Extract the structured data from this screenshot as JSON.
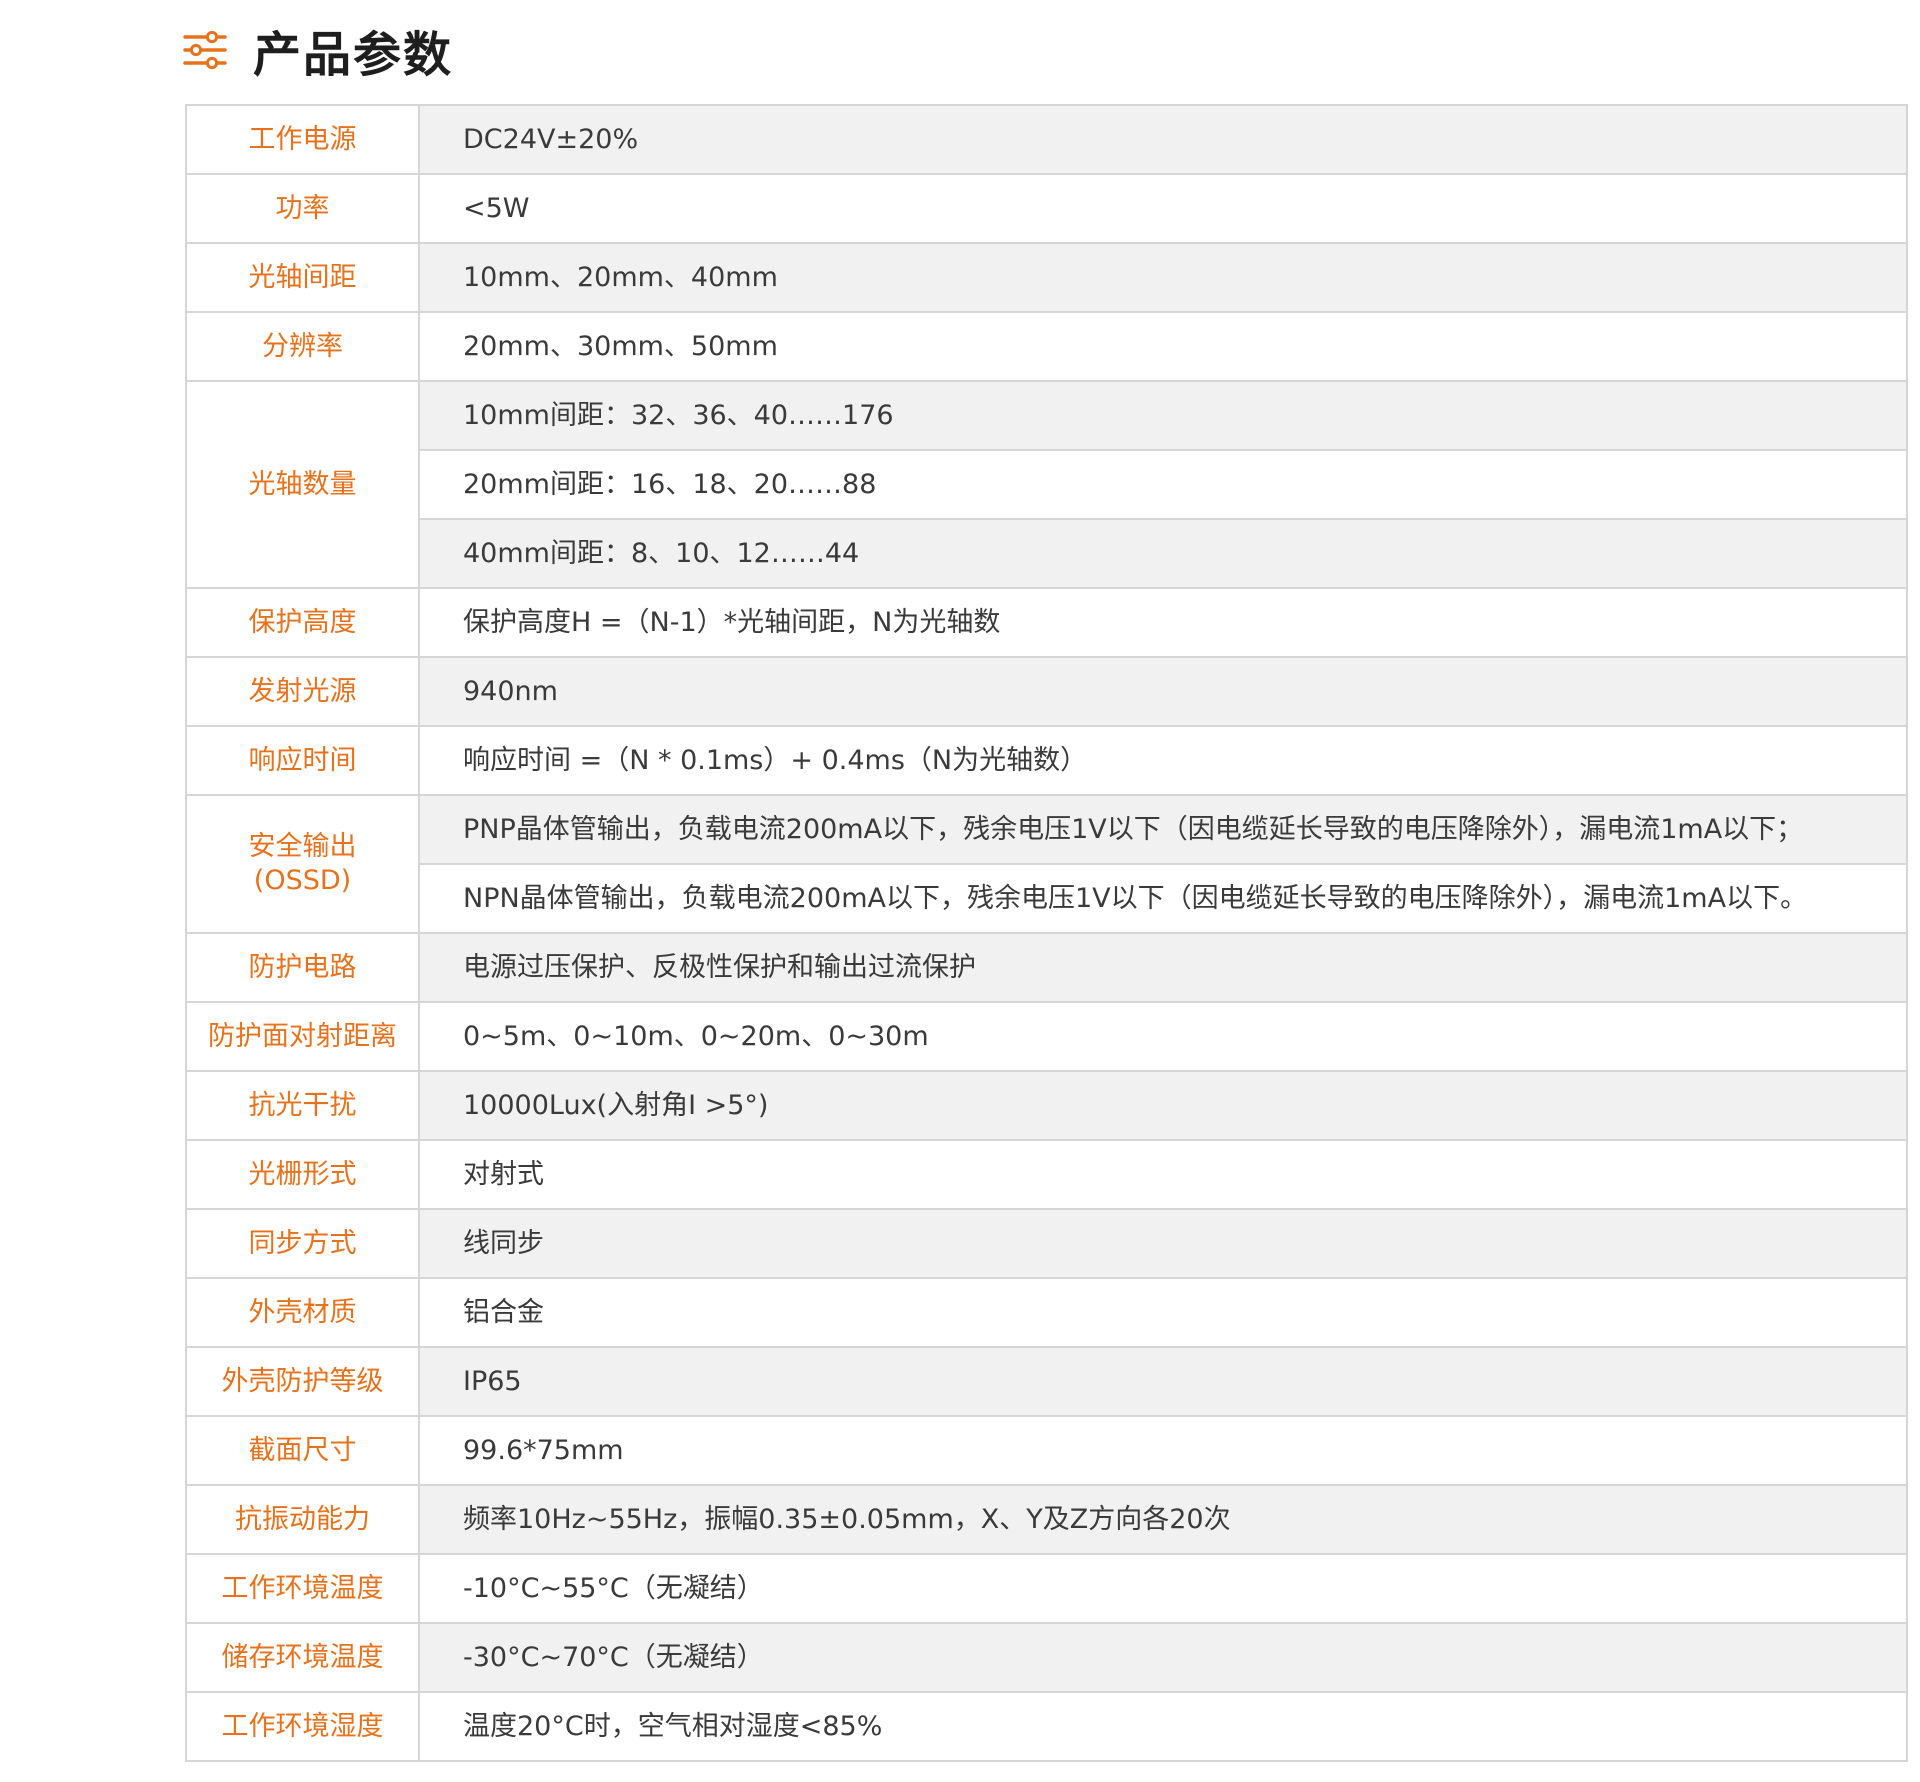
{
  "header": {
    "icon": "sliders-icon",
    "title": "产品参数"
  },
  "colors": {
    "accent": "#e8721c",
    "label_text": "#e8721c",
    "value_text": "#3a3a3a",
    "row_shade": "#f1f1f1",
    "border": "#d6d6d6"
  },
  "params": [
    {
      "label": [
        "工作电源"
      ],
      "values": [
        "DC24V±20%"
      ]
    },
    {
      "label": [
        "功率"
      ],
      "values": [
        "<5W"
      ]
    },
    {
      "label": [
        "光轴间距"
      ],
      "values": [
        "10mm、20mm、40mm"
      ]
    },
    {
      "label": [
        "分辨率"
      ],
      "values": [
        "20mm、30mm、50mm"
      ]
    },
    {
      "label": [
        "光轴数量"
      ],
      "values": [
        "10mm间距：32、36、40……176",
        "20mm间距：16、18、20……88",
        "40mm间距：8、10、12……44"
      ]
    },
    {
      "label": [
        "保护高度"
      ],
      "values": [
        "保护高度H =（N-1）*光轴间距，N为光轴数"
      ]
    },
    {
      "label": [
        "发射光源"
      ],
      "values": [
        "940nm"
      ]
    },
    {
      "label": [
        "响应时间"
      ],
      "values": [
        "响应时间 =（N * 0.1ms）+ 0.4ms（N为光轴数）"
      ]
    },
    {
      "label": [
        "安全输出",
        "(OSSD)"
      ],
      "values": [
        "PNP晶体管输出，负载电流200mA以下，残余电压1V以下（因电缆延长导致的电压降除外），漏电流1mA以下；",
        "NPN晶体管输出，负载电流200mA以下，残余电压1V以下（因电缆延长导致的电压降除外），漏电流1mA以下。"
      ]
    },
    {
      "label": [
        "防护电路"
      ],
      "values": [
        "电源过压保护、反极性保护和输出过流保护"
      ]
    },
    {
      "label": [
        "防护面对射距离"
      ],
      "values": [
        "0~5m、0~10m、0~20m、0~30m"
      ]
    },
    {
      "label": [
        "抗光干扰"
      ],
      "values": [
        "10000Lux(入射角I >5°)"
      ]
    },
    {
      "label": [
        "光栅形式"
      ],
      "values": [
        "对射式"
      ]
    },
    {
      "label": [
        "同步方式"
      ],
      "values": [
        "线同步"
      ]
    },
    {
      "label": [
        "外壳材质"
      ],
      "values": [
        "铝合金"
      ]
    },
    {
      "label": [
        "外壳防护等级"
      ],
      "values": [
        "IP65"
      ]
    },
    {
      "label": [
        "截面尺寸"
      ],
      "values": [
        "99.6*75mm"
      ]
    },
    {
      "label": [
        "抗振动能力"
      ],
      "values": [
        "频率10Hz~55Hz，振幅0.35±0.05mm，X、Y及Z方向各20次"
      ]
    },
    {
      "label": [
        "工作环境温度"
      ],
      "values": [
        "-10°C~55°C（无凝结）"
      ]
    },
    {
      "label": [
        "储存环境温度"
      ],
      "values": [
        "-30°C~70°C（无凝结）"
      ]
    },
    {
      "label": [
        "工作环境湿度"
      ],
      "values": [
        "温度20°C时，空气相对湿度<85%"
      ]
    }
  ]
}
